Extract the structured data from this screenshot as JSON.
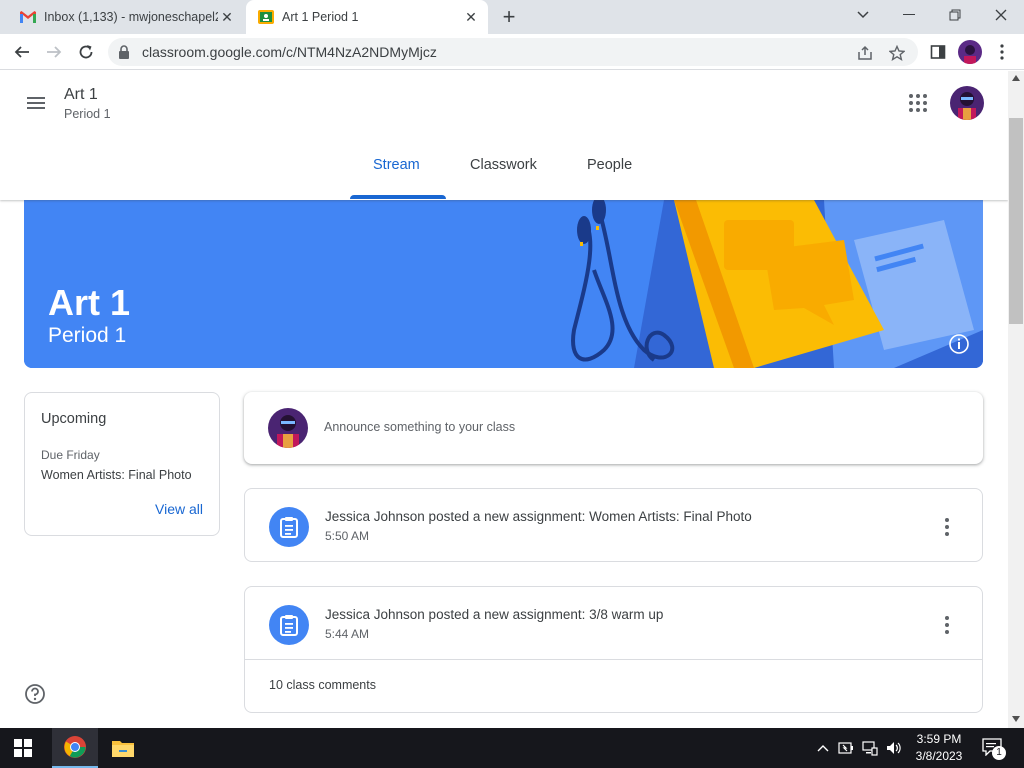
{
  "browser": {
    "tabs": [
      {
        "title": "Inbox (1,133) - mwjoneschapel26@",
        "icon": "gmail-icon"
      },
      {
        "title": "Art 1 Period 1",
        "icon": "classroom-icon"
      }
    ],
    "url": "classroom.google.com/c/NTM4NzA2NDMyMjcz"
  },
  "header": {
    "class_name": "Art 1",
    "section": "Period 1",
    "tabs": [
      {
        "label": "Stream",
        "active": true
      },
      {
        "label": "Classwork",
        "active": false
      },
      {
        "label": "People",
        "active": false
      }
    ]
  },
  "banner": {
    "title": "Art 1",
    "subtitle": "Period 1",
    "color": "#4285f4"
  },
  "upcoming": {
    "title": "Upcoming",
    "due_label": "Due Friday",
    "item": "Women Artists: Final Photo",
    "view_all": "View all"
  },
  "announce": {
    "placeholder": "Announce something to your class"
  },
  "posts": [
    {
      "title": "Jessica Johnson posted a new assignment: Women Artists: Final Photo",
      "time": "5:50 AM",
      "comments": ""
    },
    {
      "title": "Jessica Johnson posted a new assignment: 3/8 warm up",
      "time": "5:44 AM",
      "comments": "10 class comments"
    }
  ],
  "taskbar": {
    "time": "3:59 PM",
    "date": "3/8/2023",
    "notification_count": "1"
  },
  "colors": {
    "accent": "#1967d2",
    "taskbar": "#16171c"
  }
}
